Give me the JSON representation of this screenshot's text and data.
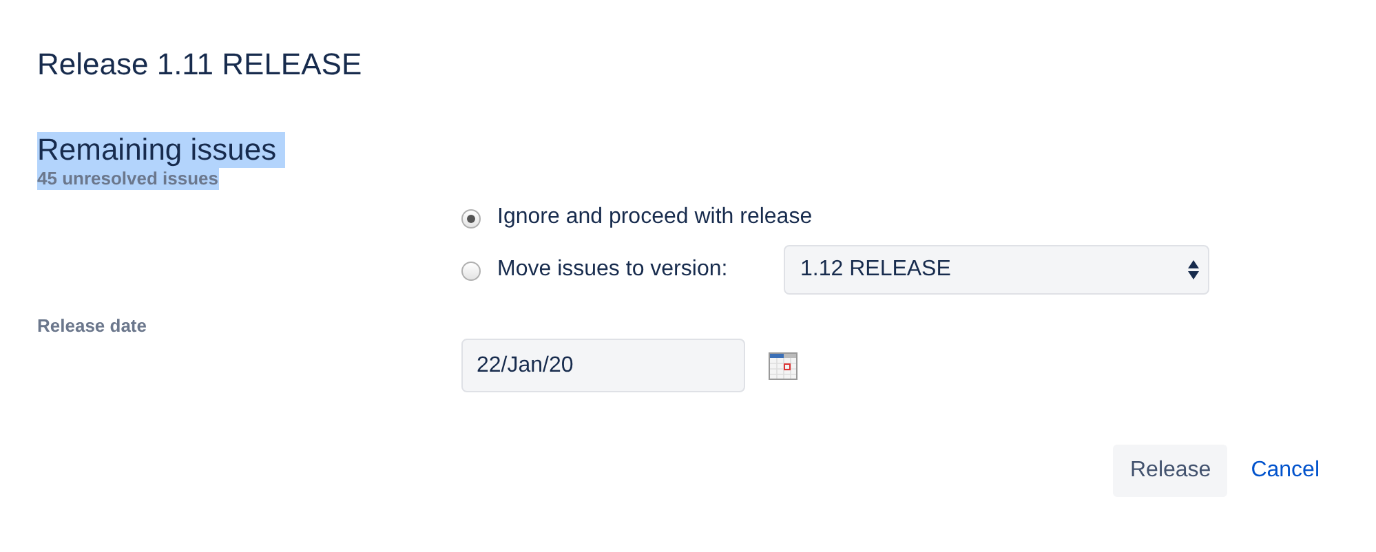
{
  "dialog": {
    "title": "Release 1.11 RELEASE"
  },
  "section": {
    "heading": "Remaining issues",
    "subtext": "45 unresolved issues"
  },
  "options": [
    {
      "label": "Ignore and proceed with release",
      "selected": true
    },
    {
      "label": "Move issues to version:",
      "selected": false
    }
  ],
  "version_select": {
    "value": "1.12 RELEASE"
  },
  "release_date": {
    "label": "Release date",
    "value": "22/Jan/20"
  },
  "buttons": {
    "primary": "Release",
    "cancel": "Cancel"
  }
}
